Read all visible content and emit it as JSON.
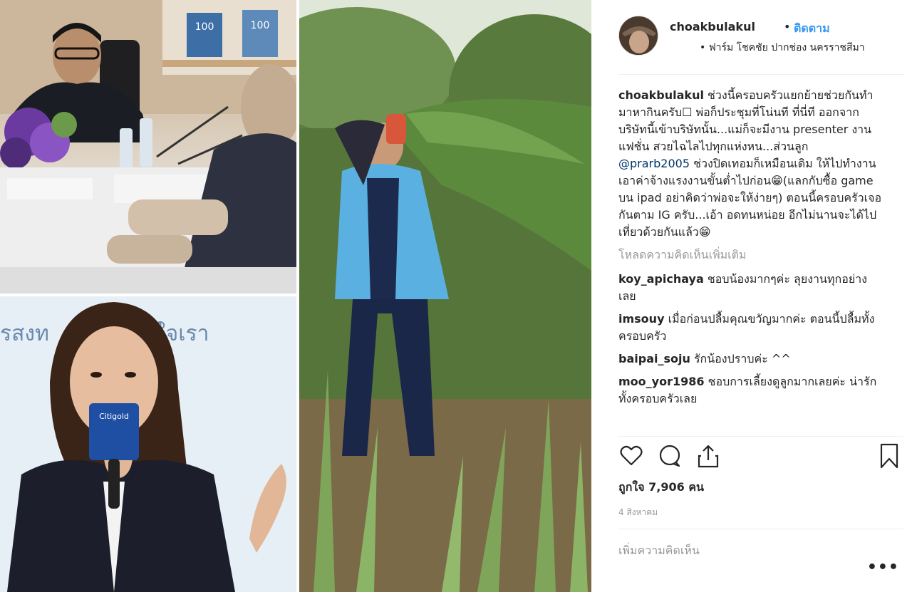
{
  "post": {
    "username": "choakbulakul",
    "separator": "•",
    "follow_label": "ติดตาม",
    "location": "• ฟาร์ม โชคชัย ปากช่อง นครราชสีมา",
    "caption": {
      "user": "choakbulakul",
      "text_before_mention": "ช่วงนี้ครอบครัวแยกย้ายช่วยกันทำมาหากินครับ☐ พ่อก็ประชุมที่โน่นที ที่นี่ที ออกจากบริษัทนี้เข้าบริษัทนั้น...แม่ก็จะมีงาน presenter งานแฟชั่น สวยไฉไลไปทุกแห่งหน...ส่วนลูก",
      "mention": "@prarb2005",
      "text_after_mention": "ช่วงปิดเทอมก็เหมือนเดิม ให้ไปทำงานเอาค่าจ้างแรงงานขั้นต่ำไปก่อน😁(แลกกับซื้อ game บน ipad อย่าคิดว่าพ่อจะให้ง่ายๆ) ตอนนี้ครอบครัวเจอกันตาม IG ครับ...เอ้า อดทนหน่อย อีกไม่นานจะได้ไปเที่ยวด้วยกันแล้ว😁"
    },
    "load_more_label": "โหลดความคิดเห็นเพิ่มเติม",
    "comments": [
      {
        "user": "koy_apichaya",
        "text": "ชอบน้องมากๆค่ะ ลุยงานทุกอย่างเลย"
      },
      {
        "user": "imsouy",
        "text": "เมื่อก่อนปลื้มคุณขวัญมากค่ะ ตอนนี้ปลื้มทั้งครอบครัว"
      },
      {
        "user": "baipai_soju",
        "text": "รักน้องปราบค่ะ ^^"
      },
      {
        "user": "moo_yor1986",
        "text": "ชอบการเลี้ยงดูลูกมากเลยค่ะ น่ารักทั้งครอบครัวเลย"
      }
    ],
    "likes_label": "ถูกใจ 7,906 คน",
    "date": "4 สิงหาคม",
    "add_comment_placeholder": "เพิ่มความคิดเห็น",
    "more_label": "•••",
    "icons": {
      "like": "heart-icon",
      "comment": "comment-icon",
      "share": "share-icon",
      "save": "bookmark-icon"
    },
    "colors": {
      "link": "#3897f0",
      "mention": "#003569",
      "muted": "#999999",
      "text": "#262626"
    }
  },
  "photos": [
    {
      "name": "meeting-photo",
      "badge_text": "100"
    },
    {
      "name": "speaker-photo",
      "mic_label": "Citigold",
      "backdrop_text": "รสงท",
      "backdrop_text_2": "ใจเรา"
    },
    {
      "name": "field-photo"
    }
  ]
}
